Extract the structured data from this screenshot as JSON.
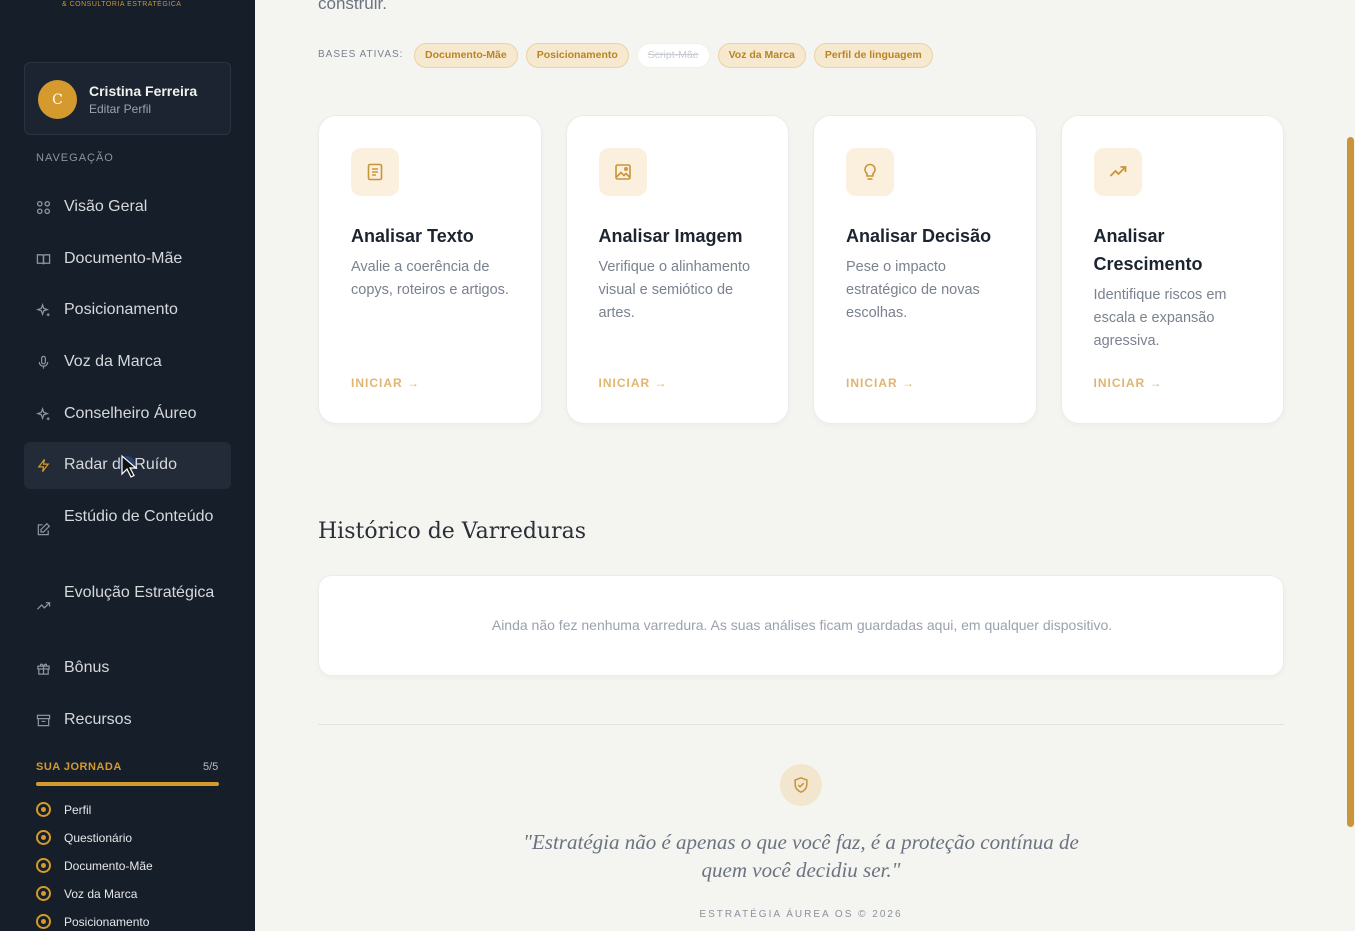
{
  "brand": {
    "subtitle": "& CONSULTORIA ESTRATÉGICA"
  },
  "profile": {
    "initial": "C",
    "name": "Cristina Ferreira",
    "action": "Editar Perfil"
  },
  "nav": {
    "heading": "NAVEGAÇÃO",
    "items": [
      {
        "label": "Visão Geral",
        "icon": "grid-icon"
      },
      {
        "label": "Documento-Mãe",
        "icon": "book-icon"
      },
      {
        "label": "Posicionamento",
        "icon": "sparkle-icon"
      },
      {
        "label": "Voz da Marca",
        "icon": "mic-icon"
      },
      {
        "label": "Conselheiro Áureo",
        "icon": "sparkle-icon"
      },
      {
        "label": "Radar de Ruído",
        "icon": "bolt-icon",
        "active": true
      },
      {
        "label": "Estúdio de Conteúdo",
        "icon": "edit-icon"
      },
      {
        "label": "Evolução Estratégica",
        "icon": "trend-icon"
      },
      {
        "label": "Bônus",
        "icon": "gift-icon"
      },
      {
        "label": "Recursos",
        "icon": "archive-icon"
      }
    ]
  },
  "journey": {
    "title": "SUA JORNADA",
    "count": "5/5",
    "progress": 1.0,
    "steps": [
      "Perfil",
      "Questionário",
      "Documento-Mãe",
      "Voz da Marca",
      "Posicionamento"
    ]
  },
  "main": {
    "lead": "construir.",
    "bases_label": "BASES ATIVAS:",
    "bases": [
      {
        "label": "Documento-Mãe",
        "active": true
      },
      {
        "label": "Posicionamento",
        "active": true
      },
      {
        "label": "Script-Mãe",
        "active": false
      },
      {
        "label": "Voz da Marca",
        "active": true
      },
      {
        "label": "Perfil de linguagem",
        "active": true
      }
    ],
    "cards": [
      {
        "title": "Analisar Texto",
        "desc": "Avalie a coerência de copys, roteiros e artigos.",
        "cta": "INICIAR →",
        "icon": "document-icon"
      },
      {
        "title": "Analisar Imagem",
        "desc": "Verifique o alinhamento visual e semiótico de artes.",
        "cta": "INICIAR →",
        "icon": "image-icon"
      },
      {
        "title": "Analisar Decisão",
        "desc": "Pese o impacto estratégico de novas escolhas.",
        "cta": "INICIAR →",
        "icon": "lightbulb-icon"
      },
      {
        "title": "Analisar Crescimento",
        "desc": "Identifique riscos em escala e expansão agressiva.",
        "cta": "INICIAR →",
        "icon": "trending-up-icon"
      }
    ],
    "history_title": "Histórico de Varreduras",
    "history_empty": "Ainda não fez nenhuma varredura. As suas análises ficam guardadas aqui, em qualquer dispositivo.",
    "quote": "\"Estratégia não é apenas o que você faz, é a proteção contínua de quem você decidiu ser.\"",
    "footer": "ESTRATÉGIA ÁUREA OS © 2026"
  },
  "colors": {
    "accent": "#d49a2e",
    "sidebar": "#161e29",
    "background": "#f4f4f1"
  }
}
